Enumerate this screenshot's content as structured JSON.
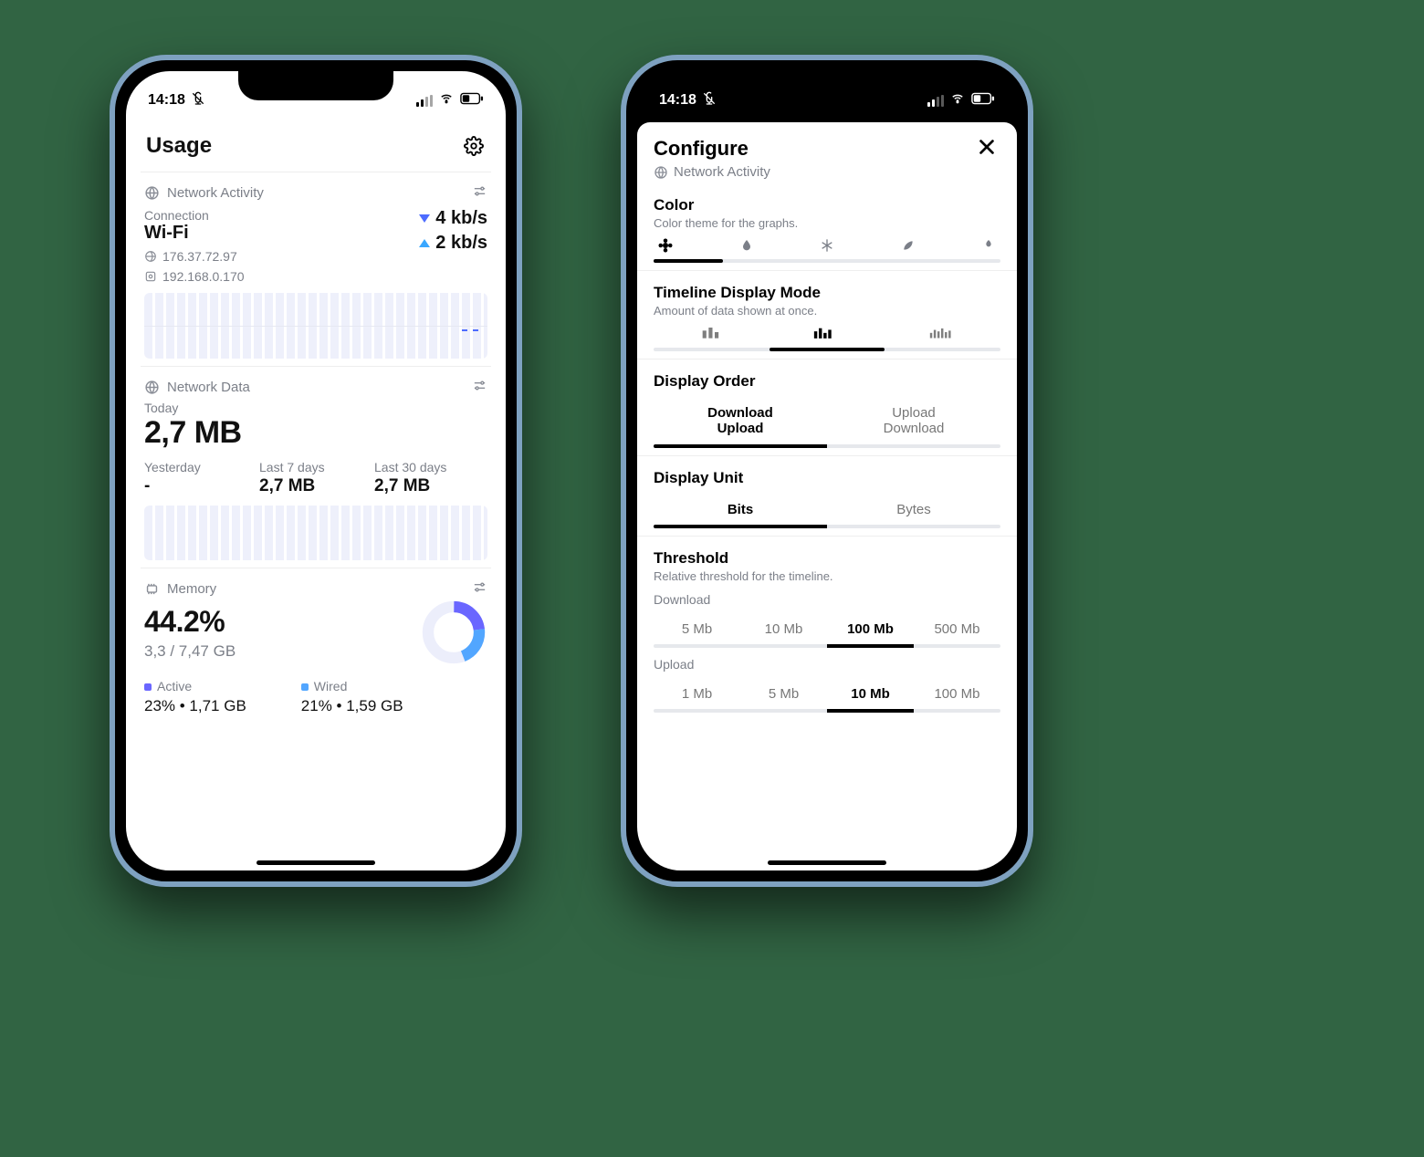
{
  "status": {
    "time": "14:18"
  },
  "left": {
    "title": "Usage",
    "network_activity": {
      "section_label": "Network Activity",
      "connection_label": "Connection",
      "connection_value": "Wi-Fi",
      "public_ip": "176.37.72.97",
      "local_ip": "192.168.0.170",
      "download_speed": "4 kb/s",
      "upload_speed": "2 kb/s"
    },
    "network_data": {
      "section_label": "Network Data",
      "today_label": "Today",
      "today_value": "2,7 MB",
      "periods": [
        {
          "label": "Yesterday",
          "value": "-"
        },
        {
          "label": "Last 7 days",
          "value": "2,7 MB"
        },
        {
          "label": "Last 30 days",
          "value": "2,7 MB"
        }
      ]
    },
    "memory": {
      "section_label": "Memory",
      "percent": "44.2%",
      "sub": "3,3 / 7,47 GB",
      "breakdown": [
        {
          "label": "Active",
          "value": "23% • 1,71 GB",
          "color": "#6a66ff"
        },
        {
          "label": "Wired",
          "value": "21% • 1,59 GB",
          "color": "#52a6ff"
        }
      ]
    }
  },
  "right": {
    "title": "Configure",
    "subtitle": "Network Activity",
    "color": {
      "title": "Color",
      "sub": "Color theme for the graphs.",
      "active_index": 0
    },
    "timeline": {
      "title": "Timeline Display Mode",
      "sub": "Amount of data shown at once.",
      "active_index": 1
    },
    "display_order": {
      "title": "Display Order",
      "options": [
        "Download\nUpload",
        "Upload\nDownload"
      ],
      "active_index": 0
    },
    "display_unit": {
      "title": "Display Unit",
      "options": [
        "Bits",
        "Bytes"
      ],
      "active_index": 0
    },
    "threshold": {
      "title": "Threshold",
      "sub": "Relative threshold for the timeline.",
      "download_label": "Download",
      "download_options": [
        "5 Mb",
        "10 Mb",
        "100 Mb",
        "500 Mb"
      ],
      "download_active_index": 2,
      "upload_label": "Upload",
      "upload_options": [
        "1 Mb",
        "5 Mb",
        "10 Mb",
        "100 Mb"
      ],
      "upload_active_index": 2
    }
  }
}
